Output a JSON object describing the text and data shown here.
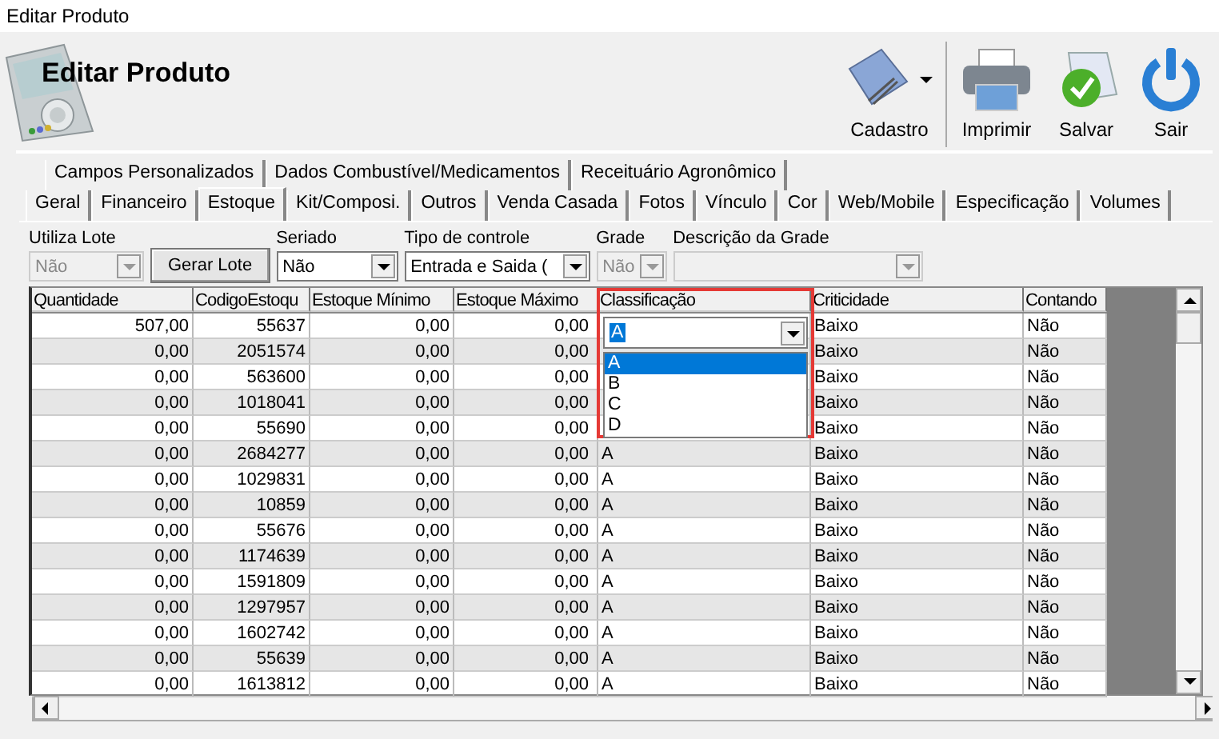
{
  "window": {
    "title": "Editar Produto"
  },
  "header": {
    "title": "Editar Produto"
  },
  "toolbar": [
    {
      "kind": "cadastro",
      "label": "Cadastro",
      "dropdown": true
    },
    {
      "kind": "print",
      "label": "Imprimir",
      "dropdown": false
    },
    {
      "kind": "save",
      "label": "Salvar",
      "dropdown": false
    },
    {
      "kind": "exit",
      "label": "Sair",
      "dropdown": false
    }
  ],
  "tab_rows": [
    [
      {
        "label": "Campos Personalizados",
        "selected": false
      },
      {
        "label": "Dados Combustível/Medicamentos",
        "selected": false
      },
      {
        "label": "Receituário Agronômico",
        "selected": false
      }
    ],
    [
      {
        "label": "Geral",
        "selected": false
      },
      {
        "label": "Financeiro",
        "selected": false
      },
      {
        "label": "Estoque",
        "selected": true
      },
      {
        "label": "Kit/Composi.",
        "selected": false
      },
      {
        "label": "Outros",
        "selected": false
      },
      {
        "label": "Venda Casada",
        "selected": false
      },
      {
        "label": "Fotos",
        "selected": false
      },
      {
        "label": "Vínculo",
        "selected": false
      },
      {
        "label": "Cor",
        "selected": false
      },
      {
        "label": "Web/Mobile",
        "selected": false
      },
      {
        "label": "Especificação",
        "selected": false
      },
      {
        "label": "Volumes",
        "selected": false
      }
    ]
  ],
  "fields": [
    {
      "kind": "combo",
      "label": "Utiliza Lote",
      "value": "Não",
      "disabled": true
    },
    {
      "kind": "button",
      "label": "Gerar Lote"
    },
    {
      "kind": "combo",
      "label": "Seriado",
      "value": "Não",
      "disabled": false
    },
    {
      "kind": "combo",
      "label": "Tipo de controle",
      "value": "Entrada e Saida (",
      "disabled": false
    },
    {
      "kind": "combo",
      "label": "Grade",
      "value": "Não",
      "disabled": true
    },
    {
      "kind": "combo",
      "label": "Descrição da Grade",
      "disabled": true
    }
  ],
  "table": {
    "columns": [
      "Quantidade",
      "CodigoEstoqu",
      "Estoque Mínimo",
      "Estoque Máximo",
      "Classificação",
      "Criticidade",
      "Contando"
    ],
    "editor": {
      "value": "A",
      "highlighted": true,
      "options": [
        {
          "label": "A",
          "selected": true
        },
        {
          "label": "B",
          "selected": false
        },
        {
          "label": "C",
          "selected": false
        },
        {
          "label": "D",
          "selected": false
        }
      ]
    },
    "rows": [
      [
        "507,00",
        "55637",
        "0,00",
        "0,00",
        null,
        "Baixo",
        "Não"
      ],
      [
        "0,00",
        "2051574",
        "0,00",
        "0,00",
        null,
        "Baixo",
        "Não"
      ],
      [
        "0,00",
        "563600",
        "0,00",
        "0,00",
        null,
        "Baixo",
        "Não"
      ],
      [
        "0,00",
        "1018041",
        "0,00",
        "0,00",
        null,
        "Baixo",
        "Não"
      ],
      [
        "0,00",
        "55690",
        "0,00",
        "0,00",
        null,
        "Baixo",
        "Não"
      ],
      [
        "0,00",
        "2684277",
        "0,00",
        "0,00",
        "A",
        "Baixo",
        "Não"
      ],
      [
        "0,00",
        "1029831",
        "0,00",
        "0,00",
        "A",
        "Baixo",
        "Não"
      ],
      [
        "0,00",
        "10859",
        "0,00",
        "0,00",
        "A",
        "Baixo",
        "Não"
      ],
      [
        "0,00",
        "55676",
        "0,00",
        "0,00",
        "A",
        "Baixo",
        "Não"
      ],
      [
        "0,00",
        "1174639",
        "0,00",
        "0,00",
        "A",
        "Baixo",
        "Não"
      ],
      [
        "0,00",
        "1591809",
        "0,00",
        "0,00",
        "A",
        "Baixo",
        "Não"
      ],
      [
        "0,00",
        "1297957",
        "0,00",
        "0,00",
        "A",
        "Baixo",
        "Não"
      ],
      [
        "0,00",
        "1602742",
        "0,00",
        "0,00",
        "A",
        "Baixo",
        "Não"
      ],
      [
        "0,00",
        "55639",
        "0,00",
        "0,00",
        "A",
        "Baixo",
        "Não"
      ],
      [
        "0,00",
        "1613812",
        "0,00",
        "0,00",
        "A",
        "Baixo",
        "Não"
      ]
    ]
  }
}
